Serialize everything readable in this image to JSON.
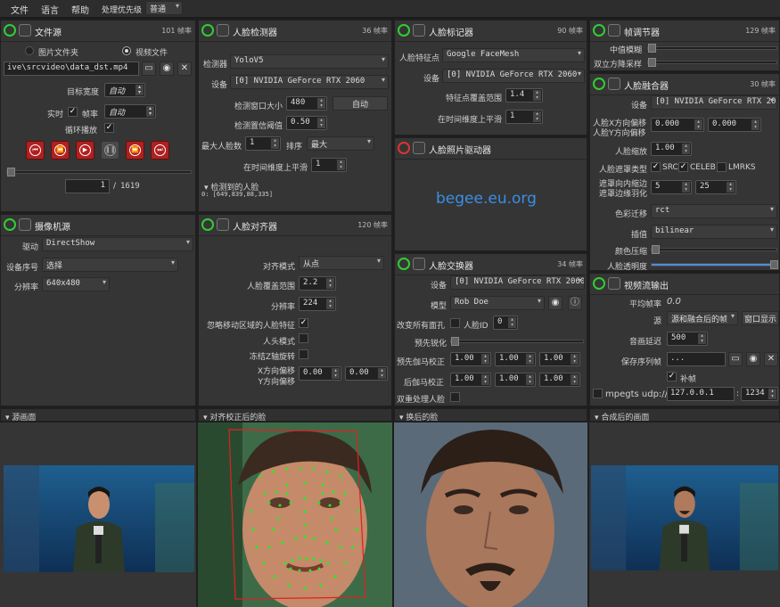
{
  "menu": {
    "file": "文件",
    "language": "语言",
    "help": "帮助",
    "priority_label": "处理优先级",
    "priority_value": "普通"
  },
  "file_source": {
    "title": "文件源",
    "fps": "101 帧率",
    "radio_folder": "图片文件夹",
    "radio_video": "视频文件",
    "path": "ive\\srcvideo\\data_dst.mp4",
    "target_width_label": "目标宽度",
    "target_width_value": "自动",
    "realtime_label": "实时",
    "fps_label": "帧率",
    "fps_value": "自动",
    "loop_label": "循环播放",
    "frame_current": "1",
    "frame_total": "1619"
  },
  "camera_source": {
    "title": "摄像机源",
    "driver_label": "驱动",
    "driver_value": "DirectShow",
    "device_label": "设备序号",
    "device_value": "选择",
    "resolution_label": "分辨率",
    "resolution_value": "640x480"
  },
  "face_detector": {
    "title": "人脸检测器",
    "fps": "36 帧率",
    "detector_label": "检测器",
    "detector_value": "YoloV5",
    "device_label": "设备",
    "device_value": "[0] NVIDIA GeForce RTX 2060",
    "window_label": "检测窗口大小",
    "window_value": "480",
    "auto_button": "自动",
    "threshold_label": "检测置信阈值",
    "threshold_value": "0.50",
    "max_faces_label": "最大人脸数",
    "max_faces_value": "1",
    "sort_label": "排序",
    "sort_value": "最大",
    "temporal_label": "在时间维度上平滑",
    "temporal_value": "1",
    "detected_label": "检测到的人脸",
    "detected_value": "0: [649,839,88,335]"
  },
  "face_aligner": {
    "title": "人脸对齐器",
    "fps": "120 帧率",
    "mode_label": "对齐模式",
    "mode_value": "从点",
    "coverage_label": "人脸覆盖范围",
    "coverage_value": "2.2",
    "resolution_label": "分辨率",
    "resolution_value": "224",
    "exclude_label": "忽略移动区域的人脸特征",
    "head_label": "人头模式",
    "freeze_label": "冻结Z轴旋转",
    "xoffset_label": "X方向偏移",
    "yoffset_label": "Y方向偏移",
    "xoffset_value": "0.00",
    "yoffset_value": "0.00"
  },
  "face_marker": {
    "title": "人脸标记器",
    "fps": "90 帧率",
    "marker_label": "人脸特征点",
    "marker_value": "Google FaceMesh",
    "device_label": "设备",
    "device_value": "[0] NVIDIA GeForce RTX 2060",
    "coverage_label": "特征点覆盖范围",
    "coverage_value": "1.4",
    "temporal_label": "在时间维度上平滑",
    "temporal_value": "1"
  },
  "face_animator": {
    "title": "人脸照片驱动器",
    "watermark": "begee.eu.org"
  },
  "face_swapper": {
    "title": "人脸交换器",
    "fps": "34 帧率",
    "device_label": "设备",
    "device_value": "[0] NVIDIA GeForce RTX 2060",
    "model_label": "模型",
    "model_value": "Rob Doe",
    "swap_all_label": "改变所有面孔",
    "face_id_label": "人脸ID",
    "face_id_value": "0",
    "presharpen_label": "预先锐化",
    "pre_gamma_label": "预先伽马校正",
    "post_gamma_label": "后伽马校正",
    "pre_gamma": [
      "1.00",
      "1.00",
      "1.00"
    ],
    "post_gamma": [
      "1.00",
      "1.00",
      "1.00"
    ],
    "two_pass_label": "双重处理人脸"
  },
  "frame_adjuster": {
    "title": "帧调节器",
    "fps": "129 帧率",
    "median_label": "中值模糊",
    "bilateral_label": "双立方降采样"
  },
  "face_merger": {
    "title": "人脸融合器",
    "fps": "30 帧率",
    "device_label": "设备",
    "device_value": "[0] NVIDIA GeForce RTX 2060",
    "xoffset_label": "人脸X方向偏移",
    "yoffset_label": "人脸Y方向偏移",
    "xoffset_value": "0.000",
    "yoffset_value": "0.000",
    "scale_label": "人脸缩放",
    "scale_value": "1.00",
    "mask_label": "人脸遮罩类型",
    "mask_src": "SRC",
    "mask_celeb": "CELEB",
    "mask_lmrks": "LMRKS",
    "erode_label": "遮罩向内缩边",
    "blur_label": "遮罩边缘羽化",
    "erode_value": "5",
    "blur_value": "25",
    "color_label": "色彩迁移",
    "color_value": "rct",
    "interp_label": "插值",
    "interp_value": "bilinear",
    "compress_label": "颜色压缩",
    "opacity_label": "人脸透明度"
  },
  "stream_output": {
    "title": "视频流输出",
    "avg_fps_label": "平均帧率",
    "avg_fps_value": "0.0",
    "source_label": "源",
    "source_value": "源和融合后的帧",
    "window_button": "窗口显示",
    "delay_label": "音画延迟",
    "delay_value": "500",
    "sequence_label": "保存序列帧",
    "sequence_value": "...",
    "fill_label": "补帧",
    "mpegts_label": "mpegts udp://",
    "ip_value": "127.0.0.1",
    "port_value": "1234"
  },
  "viewers": {
    "source": "源画面",
    "aligned": "对齐校正后的脸",
    "swapped": "换后的脸",
    "merged": "合成后的画面"
  },
  "colors": {
    "accent": "#4a8fe0",
    "power_on": "#33cc33",
    "power_off": "#dd3333",
    "panel": "#353535"
  }
}
